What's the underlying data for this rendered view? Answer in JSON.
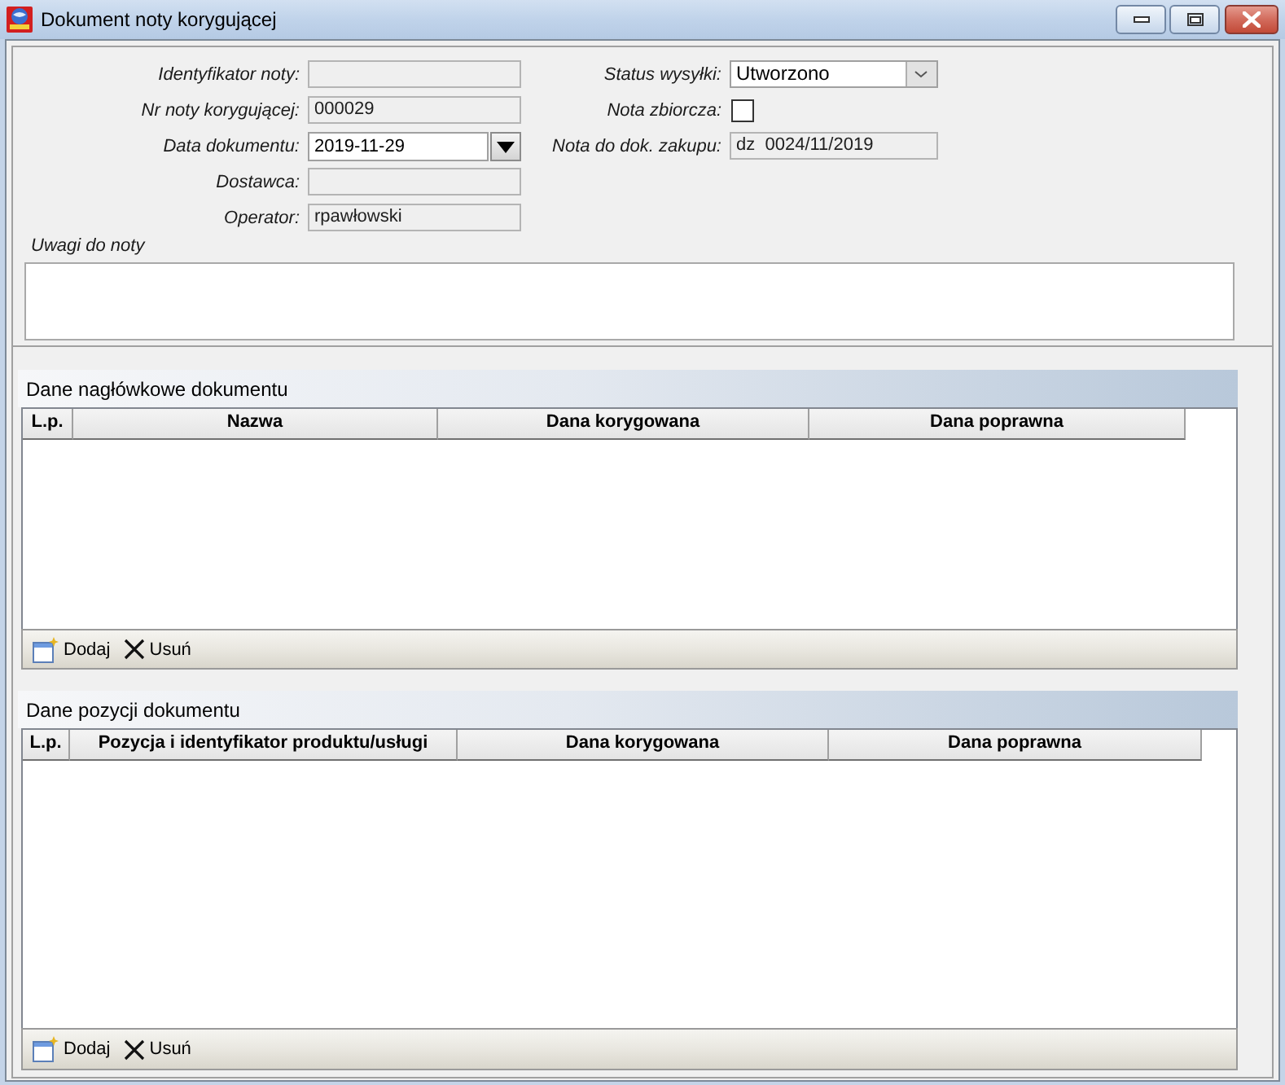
{
  "window": {
    "title": "Dokument noty korygującej"
  },
  "form": {
    "left": [
      {
        "kind": "text",
        "label": "Identyfikator noty:",
        "disabled": true
      },
      {
        "kind": "text",
        "label": "Nr noty korygującej:",
        "value": "000029",
        "disabled": true
      },
      {
        "kind": "date",
        "label": "Data dokumentu:",
        "value": "2019-11-29",
        "disabled": false
      },
      {
        "kind": "text",
        "label": "Dostawca:",
        "disabled": true
      },
      {
        "kind": "text",
        "label": "Operator:",
        "value": "rpawłowski",
        "disabled": true
      }
    ],
    "right": [
      {
        "kind": "select",
        "label": "Status wysyłki:",
        "value": "Utworzono",
        "disabled": false
      },
      {
        "kind": "checkbox",
        "label": "Nota zbiorcza:",
        "checked": false,
        "disabled": false
      },
      {
        "kind": "text",
        "label": "Nota do dok. zakupu:",
        "value": "dz  0024/11/2019",
        "disabled": true
      }
    ]
  },
  "notes": {
    "label": "Uwagi do noty"
  },
  "sections": [
    {
      "title": "Dane nagłówkowe dokumentu",
      "columns": [
        "L.p.",
        "Nazwa",
        "Dana korygowana",
        "Dana poprawna"
      ],
      "toolbar": [
        {
          "kind": "add",
          "label": "Dodaj"
        },
        {
          "kind": "remove",
          "label": "Usuń"
        }
      ]
    },
    {
      "title": "Dane pozycji dokumentu",
      "columns": [
        "L.p.",
        "Pozycja i identyfikator produktu/usługi",
        "Dana korygowana",
        "Dana poprawna"
      ],
      "toolbar": [
        {
          "kind": "add",
          "label": "Dodaj"
        },
        {
          "kind": "remove",
          "label": "Usuń"
        }
      ]
    }
  ]
}
